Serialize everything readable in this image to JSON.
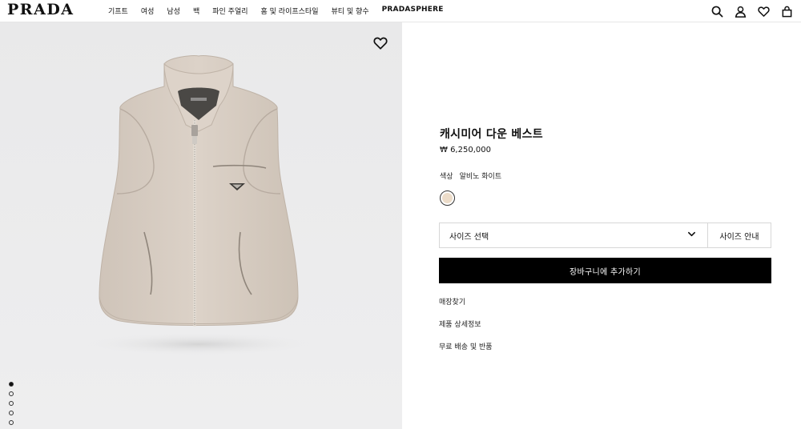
{
  "header": {
    "logo": "PRADA",
    "nav": [
      "기프트",
      "여성",
      "남성",
      "백",
      "파인 주얼리",
      "홈 및 라이프스타일",
      "뷰티 및 향수",
      "PRADASPHERE"
    ],
    "icons": [
      "search-icon",
      "account-icon",
      "wishlist-icon",
      "bag-icon"
    ]
  },
  "gallery": {
    "image_count": 5,
    "active_index": 0,
    "vest_color": "#d8cdc2"
  },
  "product": {
    "title": "캐시미어 다운 베스트",
    "price": "₩ 6,250,000",
    "color_label": "색상",
    "color_value": "알비노 화이트",
    "swatch_color": "#ecdcc9",
    "size_select_label": "사이즈 선택",
    "size_guide_label": "사이즈 안내",
    "add_to_cart_label": "장바구니에 추가하기",
    "links": [
      "매장찾기",
      "제품 상세정보",
      "무료 배송 및 반품"
    ]
  }
}
